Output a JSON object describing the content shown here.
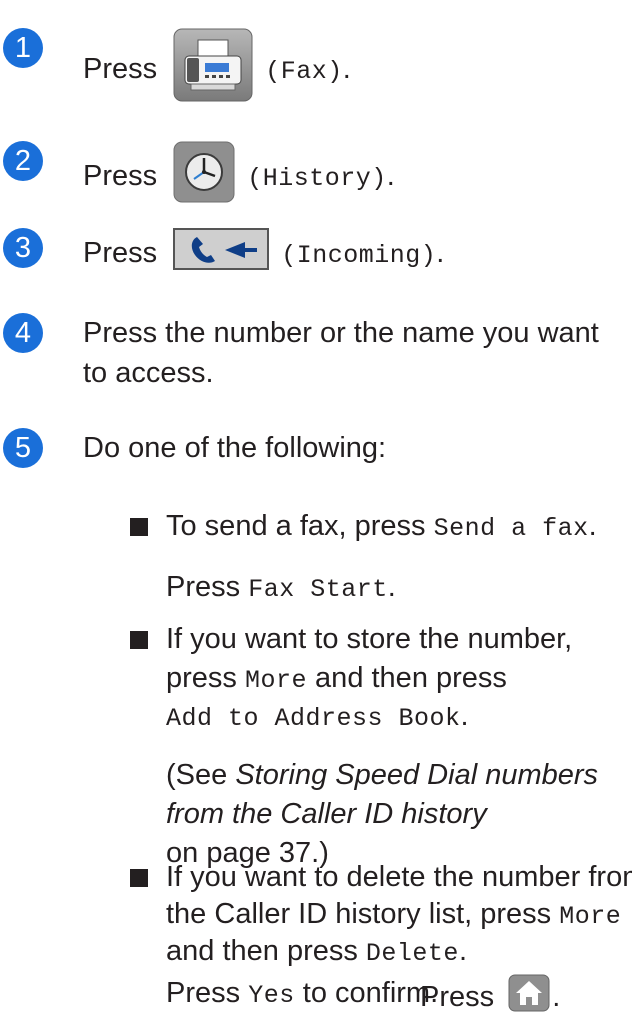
{
  "steps": [
    {
      "num": "1",
      "press": "Press",
      "code": "(Fax)",
      "after": "."
    },
    {
      "num": "2",
      "press": "Press",
      "code": "(History)",
      "after": "."
    },
    {
      "num": "3",
      "press": "Press",
      "code": "(Incoming)",
      "after": "."
    },
    {
      "num": "4",
      "line1": "Press the number or the name you want",
      "line2": "to access."
    },
    {
      "num": "5",
      "text": "Do one of the following:"
    }
  ],
  "bullets": {
    "b1": {
      "pre": "To send a fax, press ",
      "code": "Send a fax",
      "post": ".",
      "l2_pre": "Press ",
      "l2_code": "Fax Start",
      "l2_post": "."
    },
    "b2": {
      "l1": "If you want to store the number,",
      "l2_pre": "press ",
      "l2_code": "More",
      "l2_post": " and then press",
      "l3_code": "Add to Address Book",
      "l3_post": ".",
      "see_open": "(See ",
      "see_em1": "Storing Speed Dial numbers",
      "see_em2": "from the Caller ID history",
      "see_tail": "on page 37.)"
    },
    "b3": {
      "l1": "If you want to delete the number from",
      "l2_pre": "the Caller ID history list, press ",
      "l2_code": "More",
      "l3_pre": "and then press ",
      "l3_code": "Delete",
      "l3_post": ".",
      "l4_pre": "Press ",
      "l4_code": "Yes",
      "l4_post": " to confirm.",
      "l5_pre": "Press",
      "l5_post": "."
    }
  },
  "colors": {
    "step_circle": "#1a6fd9",
    "icon_grey": "#8a8a8a",
    "icon_blue": "#2f7fd0"
  },
  "icons": [
    "fax-icon",
    "history-icon",
    "incoming-icon",
    "home-icon"
  ]
}
